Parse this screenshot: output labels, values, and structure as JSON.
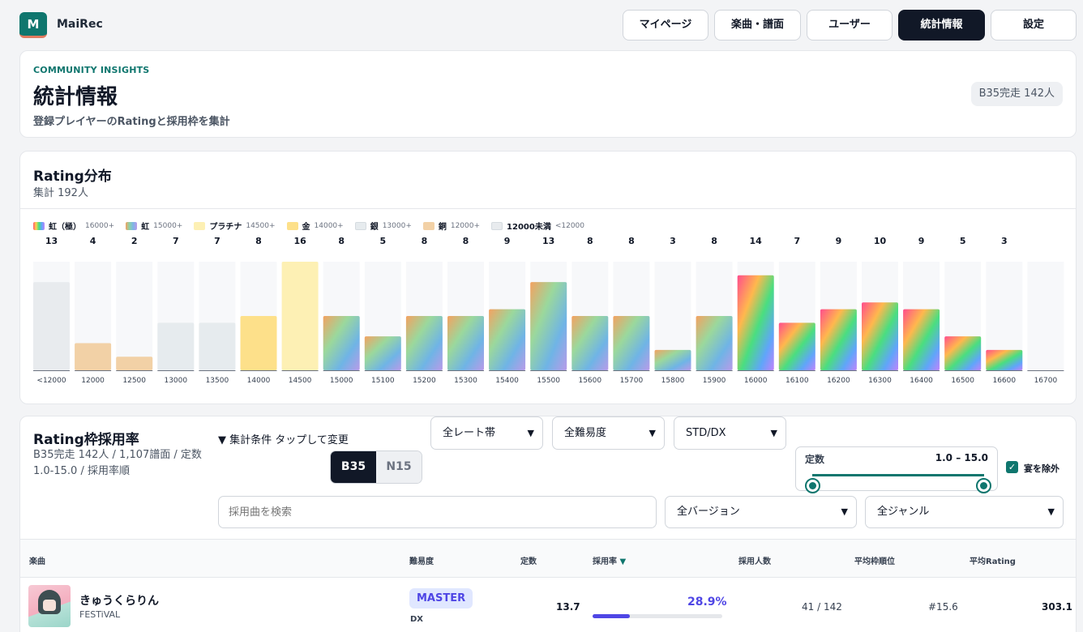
{
  "app": {
    "logo_letter": "M",
    "name": "MaiRec"
  },
  "nav": [
    {
      "label": "マイページ",
      "active": false
    },
    {
      "label": "楽曲・譜面",
      "active": false
    },
    {
      "label": "ユーザー",
      "active": false
    },
    {
      "label": "統計情報",
      "active": true
    },
    {
      "label": "設定",
      "active": false
    }
  ],
  "header": {
    "eyebrow": "COMMUNITY INSIGHTS",
    "title": "統計情報",
    "subtitle": "登録プレイヤーのRatingと採用枠を集計",
    "badge": "B35完走 142人"
  },
  "distribution": {
    "title": "Rating分布",
    "total": "集計 192人",
    "legend": [
      {
        "name": "虹（極）",
        "threshold": "16000+",
        "swatch": "rainbow"
      },
      {
        "name": "虹",
        "threshold": "15000+",
        "swatch": "rainbow-soft"
      },
      {
        "name": "プラチナ",
        "threshold": "14500+",
        "swatch": "#fdf0b4"
      },
      {
        "name": "金",
        "threshold": "14000+",
        "swatch": "#fde08a"
      },
      {
        "name": "銀",
        "threshold": "13000+",
        "swatch": "#e6ebee"
      },
      {
        "name": "銅",
        "threshold": "12000+",
        "swatch": "#f2d1a6"
      },
      {
        "name": "12000未満",
        "threshold": "<12000",
        "swatch": "#e8ebee"
      }
    ]
  },
  "chart_data": {
    "type": "bar",
    "categories": [
      "<12000",
      "12000",
      "12500",
      "13000",
      "13500",
      "14000",
      "14500",
      "15000",
      "15100",
      "15200",
      "15300",
      "15400",
      "15500",
      "15600",
      "15700",
      "15800",
      "15900",
      "16000",
      "16100",
      "16200",
      "16300",
      "16400",
      "16500",
      "16600",
      "16700"
    ],
    "values": [
      13,
      4,
      2,
      7,
      7,
      8,
      16,
      8,
      5,
      8,
      8,
      9,
      13,
      8,
      8,
      3,
      8,
      14,
      7,
      9,
      10,
      9,
      5,
      3,
      0
    ],
    "tiers": [
      "under",
      "bronze",
      "bronze",
      "silver",
      "silver",
      "gold",
      "platinum",
      "rainbow",
      "rainbow",
      "rainbow",
      "rainbow",
      "rainbow",
      "rainbow",
      "rainbow",
      "rainbow",
      "rainbow",
      "rainbow",
      "rainbow-ex",
      "rainbow-ex",
      "rainbow-ex",
      "rainbow-ex",
      "rainbow-ex",
      "rainbow-ex",
      "rainbow-ex",
      "rainbow-ex"
    ],
    "tier_colors": {
      "under": "#e8ebee",
      "bronze": "#f2d1a6",
      "silver": "#e6ebee",
      "gold": "#fde08a",
      "platinum": "#fdf0b4"
    },
    "ylim": [
      0,
      16
    ],
    "grid": false
  },
  "adoption": {
    "title": "Rating枠採用率",
    "description": "B35完走 142人 / 1,107譜面 / 定数 1.0-15.0 / 採用率順",
    "conditions_toggle": "▼ 集計条件 タップして変更",
    "mode_on": "B35",
    "mode_off": "N15",
    "rating_band": "全レート帯",
    "difficulty": "全難易度",
    "chart_type": "STD/DX",
    "constant_label": "定数",
    "constant_range": "1.0 – 15.0",
    "constant_min_pct": 0,
    "constant_max_pct": 100,
    "exclude_label": "宴を除外",
    "exclude_checked": true,
    "search_placeholder": "採用曲を検索",
    "version": "全バージョン",
    "genre": "全ジャンル",
    "columns": [
      "楽曲",
      "難易度",
      "定数",
      "採用率",
      "採用人数",
      "平均枠順位",
      "平均Rating"
    ],
    "sort_marker": "▼",
    "rows": [
      {
        "title": "きゅうくらりん",
        "category": "FESTiVAL",
        "difficulty": "MASTER",
        "type": "DX",
        "constant": "13.7",
        "rate": "28.9%",
        "rate_fraction": 0.289,
        "adopters": "41 / 142",
        "avg_rank": "#15.6",
        "avg_rating": "303.1"
      }
    ]
  }
}
